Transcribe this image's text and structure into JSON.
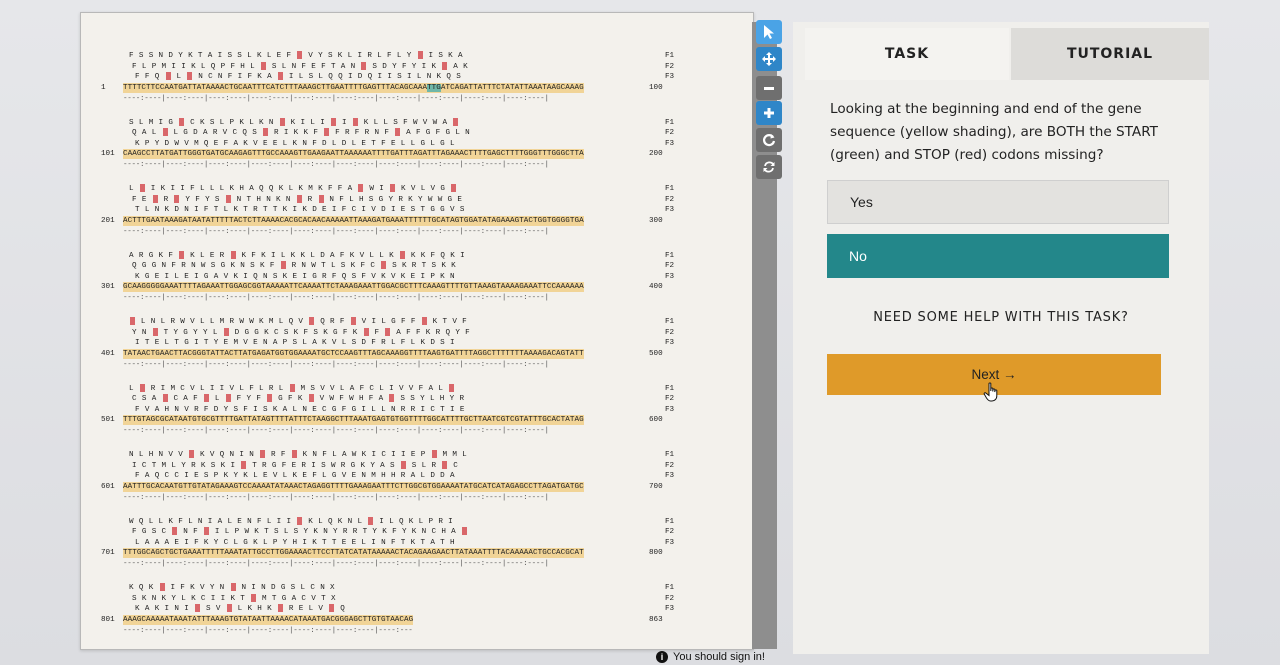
{
  "sequence_viewer": {
    "blocks": [
      {
        "f1": "F S S N D Y K T A I S S L K L E F * V Y S K L I R L F L Y * I S K A",
        "f2": "F L P M I I K L Q P F H L * S L N F E F T A N * S D Y F Y I K * A K",
        "f3": "F F Q * L * N C N F I F K A * I L S L Q Q I D Q I I S I L N K Q S",
        "start": "1",
        "dna": "TTTTCTTCCAATGATTATAAAACTGCAATTTCATCTTTAAAGCTTGAATTTTGAGTTTACAGCAAATTGATCAGATTATTTCTATATTAAATAAGCAAAG",
        "end": "100"
      },
      {
        "f1": "S L M I G * C K S L P K L K N * K I L I * I * K L L S F W V W A *",
        "f2": "Q A L * L G D A R V C Q S * R I K K F * F R F R N F * A F G F G L N",
        "f3": "K P Y D W V M Q E F A K V E E L K N F D L D L E T F E L L G L G L",
        "start": "101",
        "dna": "CAAGCCTTATGATTGGGTGATGCAAGAGTTTGCCAAAGTTGAAGAATTAAAAAATTTTGATTTAGATTTAGAAACTTTTGAGCTTTTGGGTTTGGGCTTA",
        "end": "200"
      },
      {
        "f1": "L * I K I I F L L L K H A Q Q K L K M K F F A * W I * K V L V G *",
        "f2": "F E * R * Y F Y S * N T H N K N * R * N F L H S G Y R K Y W W G E",
        "f3": "T L N K D N I F T L K T R T T K I K D E I F C I V D I E S T G G V S",
        "start": "201",
        "dna": "ACTTTGAATAAAGATAATATTTTTACTCTTAAAACACGCACAACAAAAATTAAAGATGAAATTTTTTGCATAGTGGATATAGAAAGTACTGGTGGGGTGA",
        "end": "300"
      },
      {
        "f1": "A R G K F * K L E R * K F K I L K K L D A F K V L L K * K K F Q K I",
        "f2": "Q G G N F R N W S G K N S K F * R N W T L S K F C * S K R T S K K",
        "f3": "K G E I L E I G A V K I Q N S K E I G R F Q S F V K V K E I P K N",
        "start": "301",
        "dna": "GCAAGGGGGAAATTTTAGAAATTGGAGCGGTAAAAATTCAAAATTCTAAAGAAATTGGACGCTTTCAAAGTTTTGTTAAAGTAAAAGAAATTCCAAAAAA",
        "end": "400"
      },
      {
        "f1": "* L N L R W V L L M R W W K M L Q V * Q R F * V I L G F F * K T V F",
        "f2": "Y N * T Y G Y Y L * D G G K C S K F S K G F K * F * A F F K R Q Y F",
        "f3": "I T E L T G I T Y E M V E N A P S L A K V L S D F R L F L K D S I",
        "start": "401",
        "dna": "TATAACTGAACTTACGGGTATTACTTATGAGATGGTGGAAAATGCTCCAAGTTTAGCAAAGGTTTTAAGTGATTTTAGGCTTTTTTTAAAAGACAGTATT",
        "end": "500"
      },
      {
        "f1": "L * R I M C V L I I V L F L R L * M S V V L A F C L I V V F A L *",
        "f2": "C S A * C A F * L * F Y F * G F K * V W F W H F A * S S Y L H Y R",
        "f3": "F V A H N V R F D Y S F I S K A L N E C G F G I L L N R R I C T I E",
        "start": "501",
        "dna": "TTTGTAGCGCATAATGTGCGTTTTGATTATAGTTTTATTTCTAAGGCTTTAAATGAGTGTGGTTTTGGCATTTTGCTTAATCGTCGTATTTGCACTATAG",
        "end": "600"
      },
      {
        "f1": "N L H N V V * K V Q N I N * R F * K N F L A W K I C I I E P * M M L",
        "f2": "I C T M L Y R K S K I * T R G F E R I S W R G K Y A S * S L R * C",
        "f3": "F A Q C C I E S P K Y K L E V L K E F L G V E N M H H R A L D D A",
        "start": "601",
        "dna": "AATTTGCACAATGTTGTATAGAAAGTCCAAAATATAAACTAGAGGTTTTGAAAGAATTTCTTGGCGTGGAAAATATGCATCATAGAGCCTTAGATGATGC",
        "end": "700"
      },
      {
        "f1": "W Q L L K F L N I A L E N F L I I * K L Q K N L * I L Q K L P R I",
        "f2": "F G S C * N F * I L P W K T S L S Y K N Y R R T Y K F Y K N C H A *",
        "f3": "L A A A E I F K Y C L G K L P Y H I K T T E E L I N F T K T A T H",
        "start": "701",
        "dna": "TTTGGCAGCTGCTGAAATTTTTAAATATTGCCTTGGAAAACTTCCTTATCATATAAAAACTACAGAAGAACTTATAAATTTTACAAAAACTGCCACGCAT",
        "end": "800"
      },
      {
        "f1": "K Q K * I F K V Y N * N I N D G S L C N X",
        "f2": "S K N K Y L K C I I K T * M T G A C V T X",
        "f3": "K A K I N I * S V * L K H K * R E L V * Q",
        "start": "801",
        "dna": "AAAGCAAAAATAAATATTTAAAGTGTATAATTAAAACATAAATGACGGGAGCTTGTGTAACAG",
        "end": "863"
      }
    ],
    "frame_labels": [
      "F1",
      "F2",
      "F3"
    ],
    "ruler": "----:----|----:----|----:----|----:----|----:----|----:----|----:----|----:----|----:----|----:----|",
    "ruler_last": "----:----|----:----|----:----|----:----|----:----|----:----|----:---"
  },
  "toolbar": {
    "items": [
      "pointer-icon",
      "move-icon",
      "zoom-out-icon",
      "zoom-in-icon",
      "refresh-icon",
      "reset-icon"
    ]
  },
  "footer": {
    "signin_text": "You should sign in!"
  },
  "tabs": {
    "task": "TASK",
    "tutorial": "TUTORIAL"
  },
  "question": "Looking at the beginning and end of the gene sequence (yellow shading), are BOTH the START (green) and STOP (red) codons missing?",
  "options": {
    "yes": "Yes",
    "no": "No"
  },
  "help_text": "NEED SOME HELP WITH THIS TASK?",
  "next_label": "Next →",
  "colors": {
    "accent_teal": "#23878a",
    "next_orange": "#df9a29",
    "dna_shade": "#f1d497",
    "stop_red": "#d9676a",
    "toolbar_blue": "#2f86c8"
  }
}
